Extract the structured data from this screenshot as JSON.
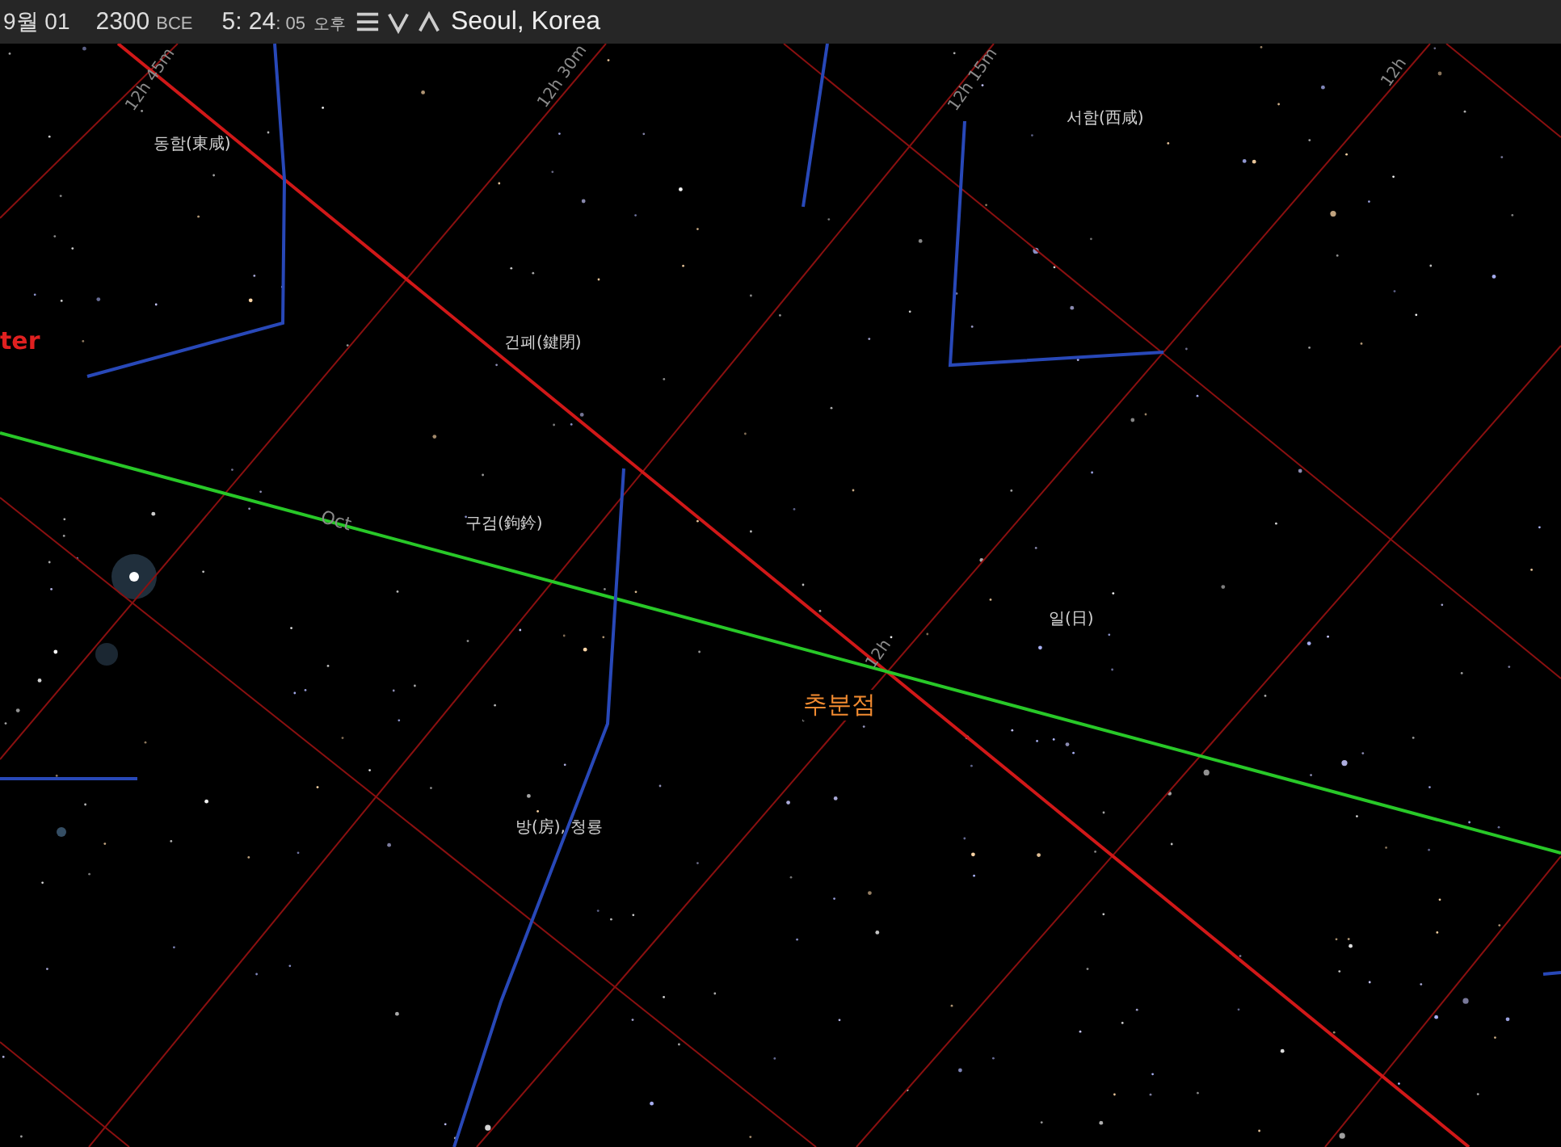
{
  "top_bar": {
    "date": "9월 01",
    "year": "2300",
    "era": "BCE",
    "time": "5: 24",
    "seconds": ": 05",
    "meridiem": "오후",
    "location": "Seoul, Korea"
  },
  "sky_labels": [
    {
      "kind": "grid",
      "text": "12h 45m"
    },
    {
      "kind": "grid",
      "text": "12h 30m"
    },
    {
      "kind": "grid",
      "text": "12h 15m"
    },
    {
      "kind": "grid",
      "text": "12h"
    },
    {
      "kind": "asterism",
      "text": "동함(東咸)"
    },
    {
      "kind": "asterism",
      "text": "서함(西咸)"
    },
    {
      "kind": "planet",
      "text": "ter"
    },
    {
      "kind": "asterism",
      "text": "건폐(鍵閉)"
    },
    {
      "kind": "month",
      "text": "Oct"
    },
    {
      "kind": "asterism",
      "text": "구검(鉤鈐)"
    },
    {
      "kind": "asterism",
      "text": "일(日)"
    },
    {
      "kind": "grid",
      "text": "12h"
    },
    {
      "kind": "point",
      "text": "추분점"
    },
    {
      "kind": "asterism",
      "text": "방(房), 청룡"
    }
  ]
}
